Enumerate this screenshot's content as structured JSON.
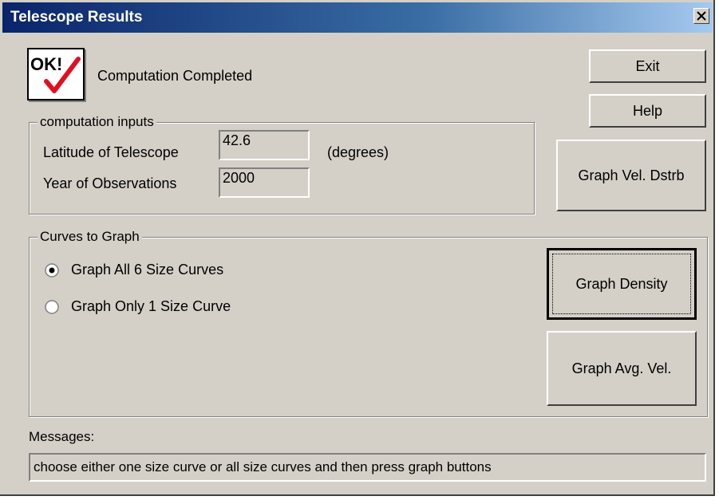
{
  "window": {
    "title": "Telescope Results"
  },
  "status": {
    "icon_text": "OK!",
    "text": "Computation Completed"
  },
  "buttons": {
    "exit": "Exit",
    "help": "Help",
    "graph_vel_dstrb": "Graph Vel. Dstrb",
    "graph_density": "Graph Density",
    "graph_avg_vel": "Graph Avg. Vel."
  },
  "inputs": {
    "legend": "computation inputs",
    "latitude_label": "Latitude of Telescope",
    "latitude_value": "42.6",
    "latitude_unit": "(degrees)",
    "year_label": "Year of Observations",
    "year_value": "2000"
  },
  "curves": {
    "legend": "Curves to Graph",
    "options": [
      {
        "label": "Graph All 6 Size Curves",
        "selected": true
      },
      {
        "label": "Graph Only 1 Size Curve",
        "selected": false
      }
    ]
  },
  "messages": {
    "label": "Messages:",
    "text": "choose either one size curve or all size curves and then press graph buttons"
  },
  "colors": {
    "face": "#d4d0c8",
    "title_start": "#0a246a",
    "title_end": "#a6caf0",
    "check": "#e01020"
  }
}
